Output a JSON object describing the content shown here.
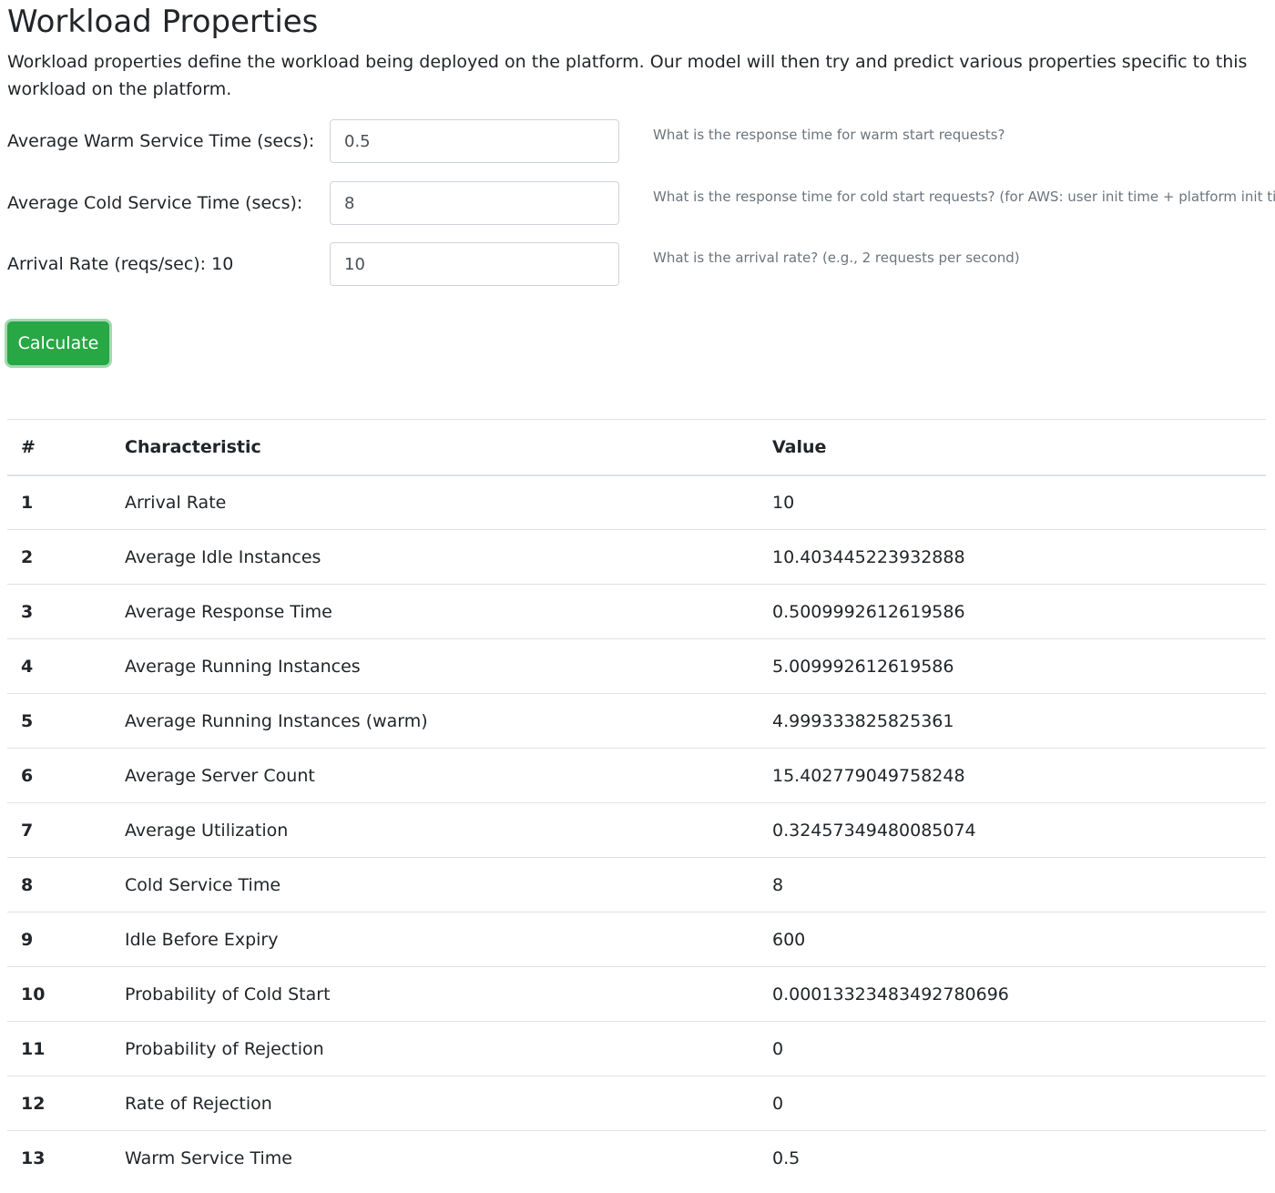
{
  "page": {
    "title": "Workload Properties",
    "description": "Workload properties define the workload being deployed on the platform. Our model will then try and predict various properties specific to this workload on the platform."
  },
  "form": {
    "warm": {
      "label": "Average Warm Service Time (secs):",
      "value": "0.5",
      "help": "What is the response time for warm start requests?"
    },
    "cold": {
      "label": "Average Cold Service Time (secs):",
      "value": "8",
      "help": "What is the response time for cold start requests? (for AWS: user init time + platform init time)"
    },
    "arrival": {
      "label": "Arrival Rate (reqs/sec): 10",
      "value": "10",
      "help": "What is the arrival rate? (e.g., 2 requests per second)"
    },
    "calculate_label": "Calculate",
    "button_color": "#28a745"
  },
  "table": {
    "headers": [
      "#",
      "Characteristic",
      "Value"
    ],
    "rows": [
      {
        "num": "1",
        "name": "Arrival Rate",
        "value": "10"
      },
      {
        "num": "2",
        "name": "Average Idle Instances",
        "value": "10.403445223932888"
      },
      {
        "num": "3",
        "name": "Average Response Time",
        "value": "0.5009992612619586"
      },
      {
        "num": "4",
        "name": "Average Running Instances",
        "value": "5.009992612619586"
      },
      {
        "num": "5",
        "name": "Average Running Instances (warm)",
        "value": "4.999333825825361"
      },
      {
        "num": "6",
        "name": "Average Server Count",
        "value": "15.402779049758248"
      },
      {
        "num": "7",
        "name": "Average Utilization",
        "value": "0.32457349480085074"
      },
      {
        "num": "8",
        "name": "Cold Service Time",
        "value": "8"
      },
      {
        "num": "9",
        "name": "Idle Before Expiry",
        "value": "600"
      },
      {
        "num": "10",
        "name": "Probability of Cold Start",
        "value": "0.00013323483492780696"
      },
      {
        "num": "11",
        "name": "Probability of Rejection",
        "value": "0"
      },
      {
        "num": "12",
        "name": "Rate of Rejection",
        "value": "0"
      },
      {
        "num": "13",
        "name": "Warm Service Time",
        "value": "0.5"
      }
    ]
  }
}
